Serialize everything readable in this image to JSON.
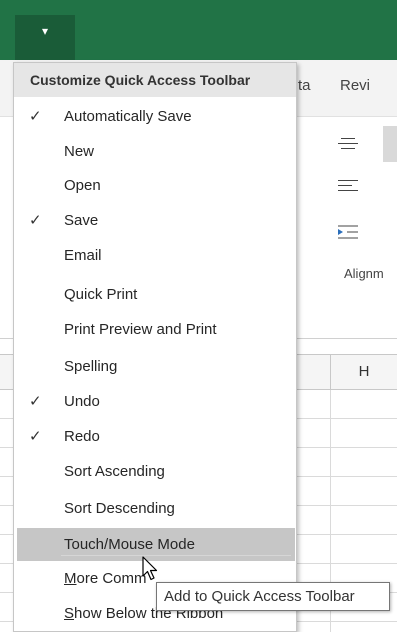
{
  "qat": {
    "dropdown_glyph": "▾"
  },
  "ribbon": {
    "tab_partial_1": "ta",
    "tab_partial_2": "Revi",
    "group_label": "Alignm"
  },
  "grid": {
    "column_h": "H"
  },
  "menu": {
    "title": "Customize Quick Access Toolbar",
    "items": [
      {
        "label": "Automatically Save",
        "checked": true
      },
      {
        "label": "New",
        "checked": false
      },
      {
        "label": "Open",
        "checked": false
      },
      {
        "label": "Save",
        "checked": true
      },
      {
        "label": "Email",
        "checked": false
      },
      {
        "label": "Quick Print",
        "checked": false
      },
      {
        "label": "Print Preview and Print",
        "checked": false
      },
      {
        "label": "Spelling",
        "checked": false
      },
      {
        "label": "Undo",
        "checked": true
      },
      {
        "label": "Redo",
        "checked": true
      },
      {
        "label": "Sort Ascending",
        "checked": false
      },
      {
        "label": "Sort Descending",
        "checked": false
      },
      {
        "label": "Touch/Mouse Mode",
        "checked": false,
        "highlighted": true
      }
    ],
    "more_commands_label": "More Comm",
    "more_commands_mnemonic": "M",
    "more_commands_rest": "ore Comm",
    "show_below_mnemonic": "S",
    "show_below_rest": "how Below the Ribbon",
    "check_glyph": "✓"
  },
  "tooltip": {
    "text": "Add to Quick Access Toolbar"
  },
  "colors": {
    "excel_green": "#217346",
    "menu_hover": "#c6c6c6",
    "menu_header": "#e6e6e6"
  }
}
